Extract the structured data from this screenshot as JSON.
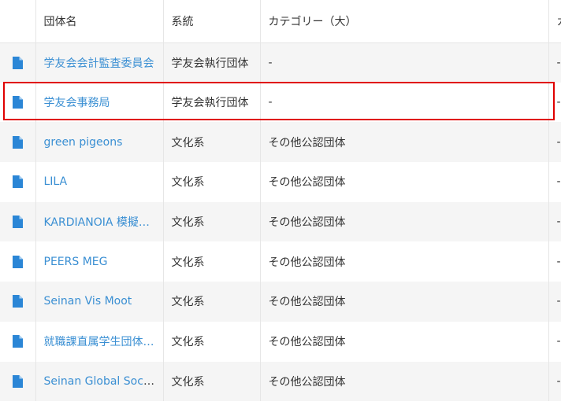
{
  "table": {
    "headers": {
      "name": "団体名",
      "system": "系統",
      "category": "カテゴリー（大）",
      "more": "カ"
    },
    "rows": [
      {
        "name": "学友会会計監査委員会",
        "system": "学友会執行団体",
        "category": "-",
        "more": "-"
      },
      {
        "name": "学友会事務局",
        "system": "学友会執行団体",
        "category": "-",
        "more": "-"
      },
      {
        "name": "green pigeons",
        "system": "文化系",
        "category": "その他公認団体",
        "more": "-"
      },
      {
        "name": "LILA",
        "system": "文化系",
        "category": "その他公認団体",
        "more": "-"
      },
      {
        "name": "KARDIANOIA 模擬…",
        "system": "文化系",
        "category": "その他公認団体",
        "more": "-"
      },
      {
        "name": "PEERS MEG",
        "system": "文化系",
        "category": "その他公認団体",
        "more": "-"
      },
      {
        "name": "Seinan Vis Moot",
        "system": "文化系",
        "category": "その他公認団体",
        "more": "-"
      },
      {
        "name": "就職課直属学生団体…",
        "system": "文化系",
        "category": "その他公認団体",
        "more": "-"
      },
      {
        "name": "Seinan Global Soci…",
        "system": "文化系",
        "category": "その他公認団体",
        "more": "-"
      }
    ],
    "icon": "document-icon",
    "link_color": "#3a8fd3",
    "icon_color": "#2b86d6",
    "highlight_color": "#e00000"
  }
}
